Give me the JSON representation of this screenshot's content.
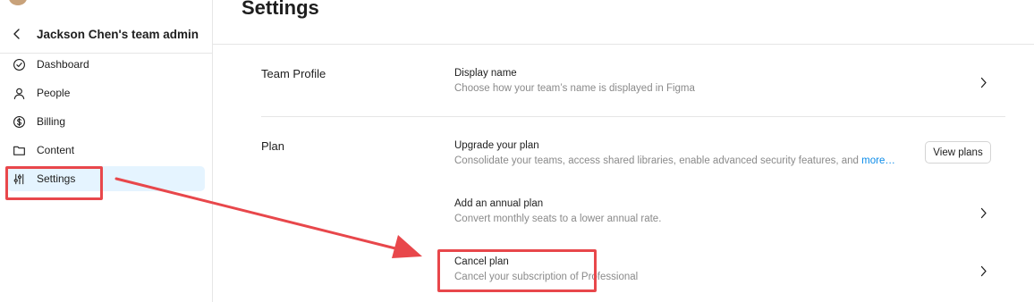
{
  "sidebar": {
    "team_name": "Jackson Chen's team admin",
    "items": [
      {
        "label": "Dashboard",
        "icon": "check-circle-icon"
      },
      {
        "label": "People",
        "icon": "person-icon"
      },
      {
        "label": "Billing",
        "icon": "dollar-circle-icon"
      },
      {
        "label": "Content",
        "icon": "folder-icon"
      },
      {
        "label": "Settings",
        "icon": "sliders-icon",
        "active": true
      }
    ]
  },
  "main": {
    "title": "Settings",
    "sections": [
      {
        "label": "Team Profile",
        "rows": [
          {
            "title": "Display name",
            "description": "Choose how your team’s name is displayed in Figma"
          }
        ]
      },
      {
        "label": "Plan",
        "rows": [
          {
            "title": "Upgrade your plan",
            "description": "Consolidate your teams, access shared libraries, enable advanced security features, and",
            "more": "more…",
            "action": "View plans"
          },
          {
            "title": "Add an annual plan",
            "description": "Convert monthly seats to a lower annual rate."
          },
          {
            "title": "Cancel plan",
            "description": "Cancel your subscription of Professional"
          }
        ]
      }
    ]
  },
  "colors": {
    "accent": "#0c8ce9",
    "active_nav_bg": "#e5f4ff",
    "annotation": "#e8474b",
    "muted_text": "#8a8a8a",
    "divider": "#e6e6e6"
  }
}
